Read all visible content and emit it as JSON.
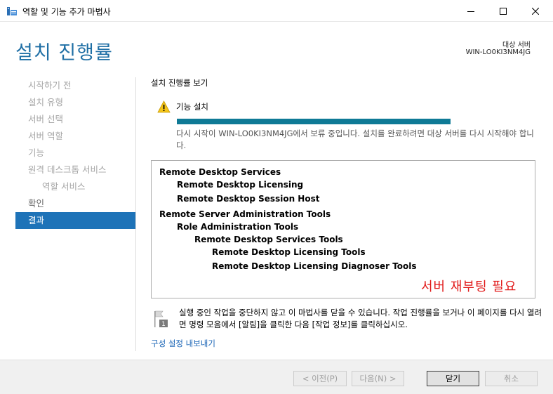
{
  "window": {
    "title": "역할 및 기능 추가 마법사",
    "icon": "server-manager-icon"
  },
  "header": {
    "page_title": "설치 진행률",
    "dest_label": "대상 서버",
    "dest_server": "WIN-LO0KI3NM4JG"
  },
  "nav": {
    "items": [
      {
        "label": "시작하기 전",
        "state": "disabled"
      },
      {
        "label": "설치 유형",
        "state": "disabled"
      },
      {
        "label": "서버 선택",
        "state": "disabled"
      },
      {
        "label": "서버 역할",
        "state": "disabled"
      },
      {
        "label": "기능",
        "state": "disabled"
      },
      {
        "label": "원격 데스크톱 서비스",
        "state": "disabled"
      },
      {
        "label": "역할 서비스",
        "state": "disabled"
      },
      {
        "label": "확인",
        "state": "normal"
      },
      {
        "label": "결과",
        "state": "active"
      }
    ]
  },
  "content": {
    "section_title": "설치 진행률 보기",
    "task_label": "기능 설치",
    "progress_percent": 100,
    "progress_color": "#0f7a96",
    "pending_message": "다시 시작이 WIN-LO0KI3NM4JG에서 보류 중입니다. 설치를 완료하려면 대상 서버를 다시 시작해야 합니다.",
    "features": [
      {
        "label": "Remote Desktop Services",
        "level": 0
      },
      {
        "label": "Remote Desktop Licensing",
        "level": 1
      },
      {
        "label": "Remote Desktop Session Host",
        "level": 1
      },
      {
        "label": "Remote Server Administration Tools",
        "level": 0
      },
      {
        "label": "Role Administration Tools",
        "level": 1
      },
      {
        "label": "Remote Desktop Services Tools",
        "level": 2
      },
      {
        "label": "Remote Desktop Licensing Tools",
        "level": 3
      },
      {
        "label": "Remote Desktop Licensing Diagnoser Tools",
        "level": 3
      }
    ],
    "reboot_note": "서버 재부팅 필요",
    "reboot_note_color": "#e11a1a",
    "info_message": "실행 중인 작업을 중단하지 않고 이 마법사를 닫을 수 있습니다. 작업 진행률을 보거나 이 페이지를 다시 열려면 명령 모음에서 [알림]을 클릭한 다음 [작업 정보]를 클릭하십시오.",
    "flag_badge": "1",
    "export_link": "구성 설정 내보내기"
  },
  "footer": {
    "prev_label": "< 이전(P)",
    "next_label": "다음(N) >",
    "close_label": "닫기",
    "cancel_label": "취소"
  }
}
